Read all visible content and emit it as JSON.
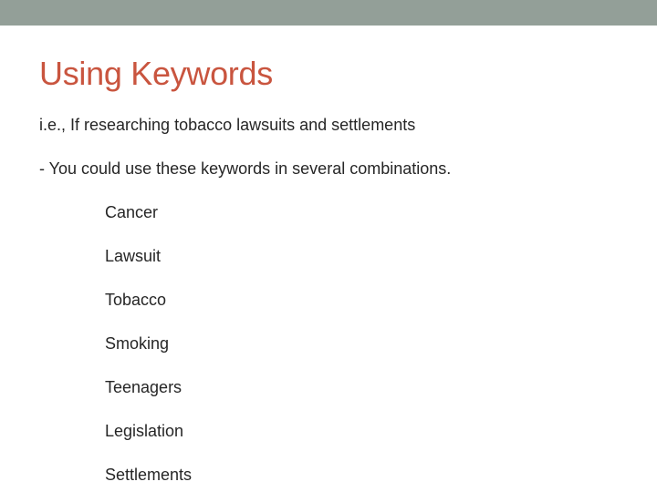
{
  "slide": {
    "title": "Using Keywords",
    "intro": "i.e., If researching tobacco lawsuits and settlements",
    "instruction": "- You could use these keywords in several combinations.",
    "keywords": [
      "Cancer",
      "Lawsuit",
      "Tobacco",
      "Smoking",
      "Teenagers",
      "Legislation",
      "Settlements"
    ]
  },
  "colors": {
    "header_bar": "#939f98",
    "title": "#c9553f",
    "body_text": "#262626"
  }
}
